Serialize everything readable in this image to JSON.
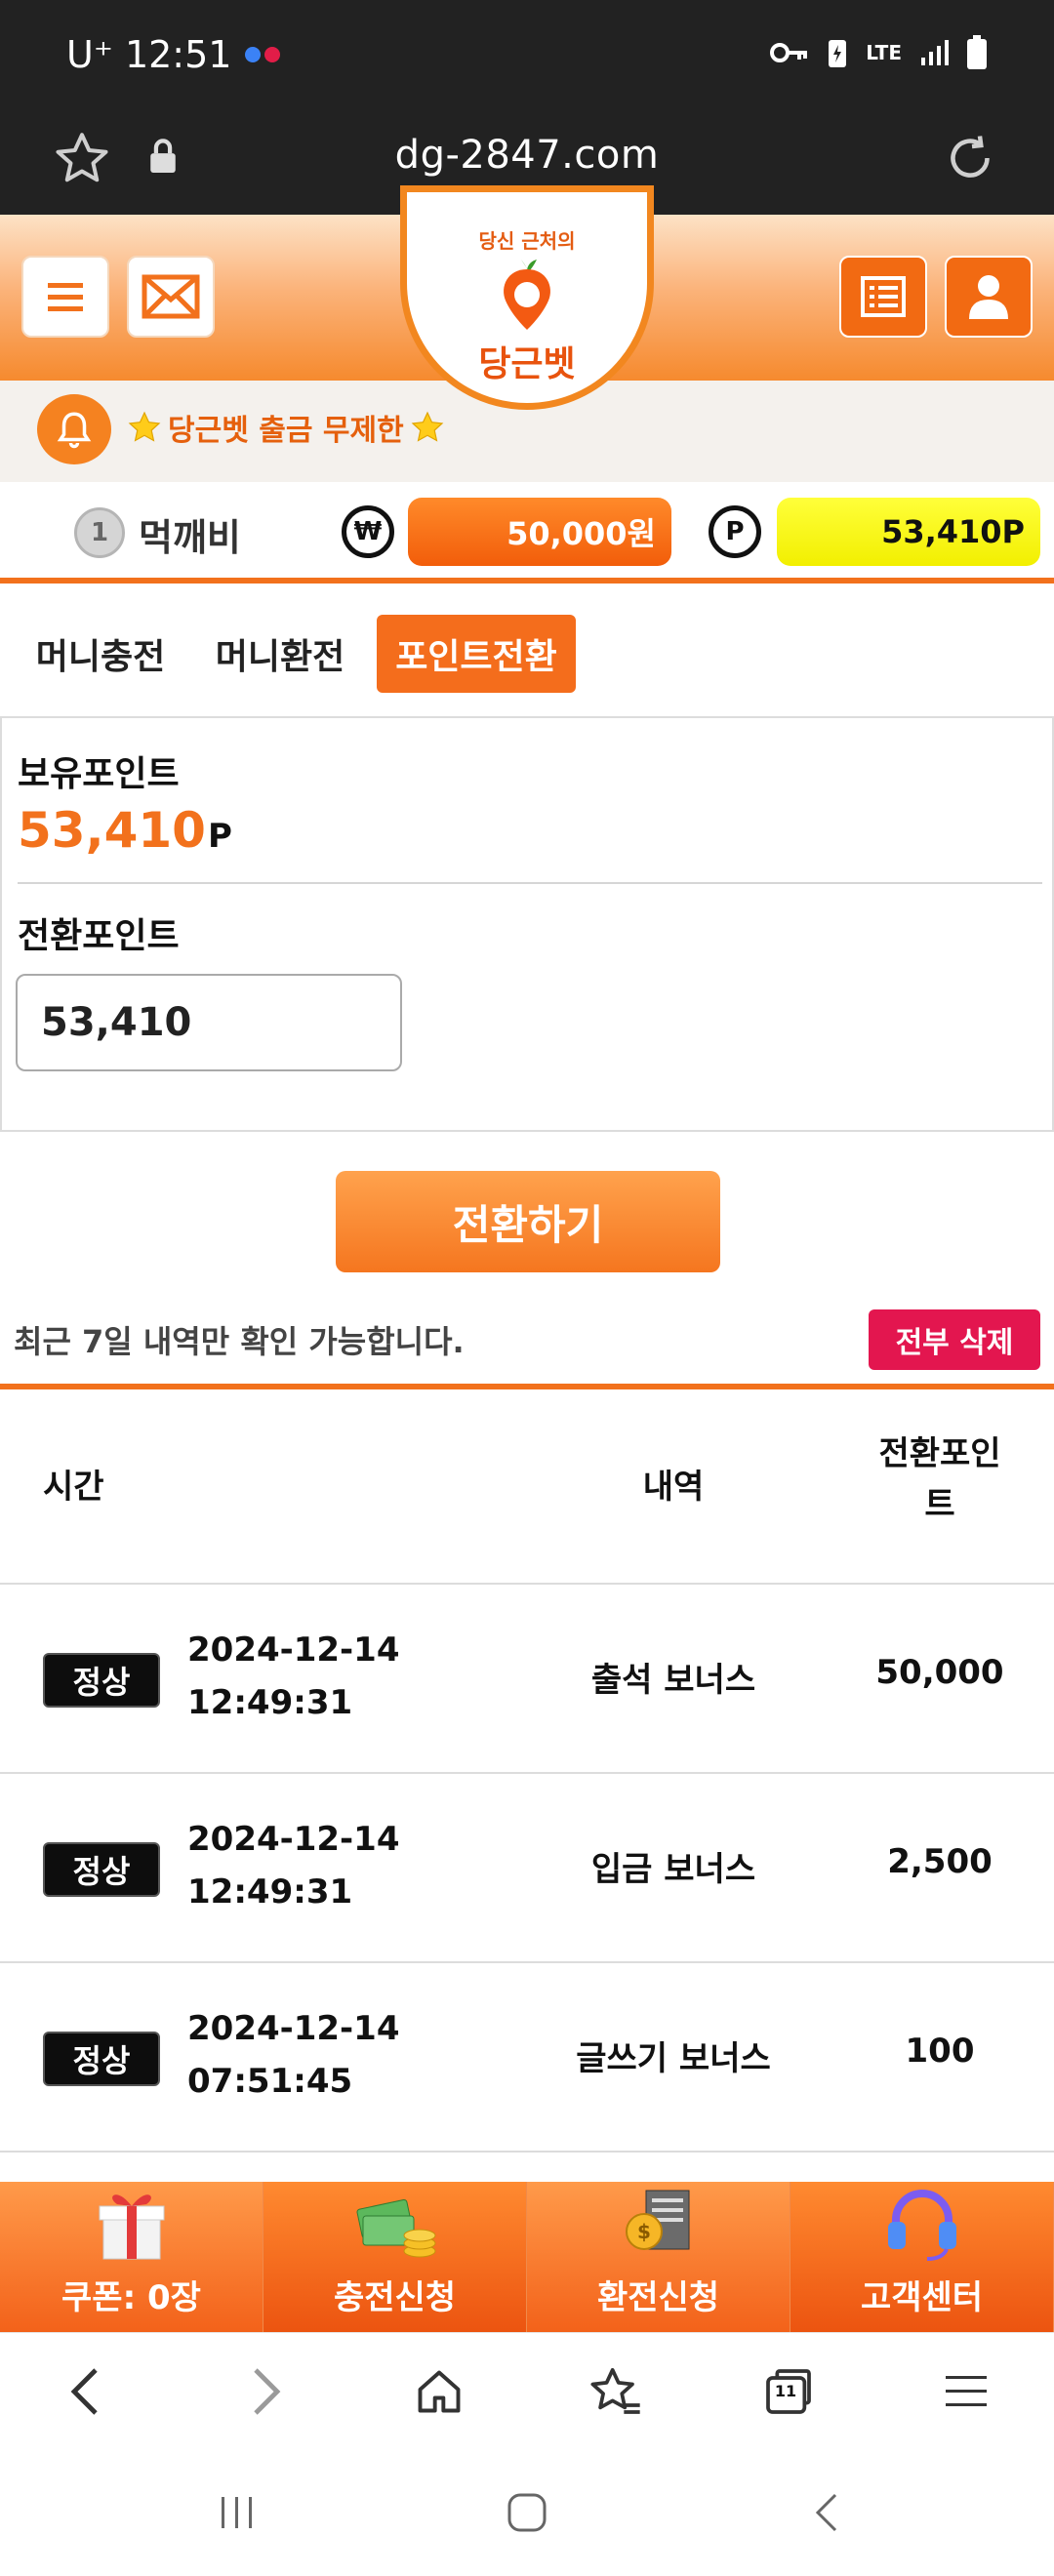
{
  "status_bar": {
    "carrier_time": "U⁺ 12:51",
    "network": "LTE"
  },
  "browser": {
    "url": "dg-2847.com"
  },
  "site": {
    "logo_tagline": "당신 근처의",
    "logo_name": "당근벳",
    "notice": "당근벳 출금 무제한"
  },
  "balance": {
    "level_badge": "1",
    "username": "먹깨비",
    "money_symbol": "₩",
    "money": "50,000원",
    "point_symbol": "P",
    "points": "53,410P"
  },
  "tabs": [
    {
      "label": "머니충전",
      "active": false
    },
    {
      "label": "머니환전",
      "active": false
    },
    {
      "label": "포인트전환",
      "active": true
    }
  ],
  "form": {
    "held_points_label": "보유포인트",
    "held_points_value": "53,410",
    "held_points_unit": "P",
    "convert_points_label": "전환포인트",
    "convert_points_input": "53,410",
    "convert_button": "전환하기"
  },
  "history": {
    "note": "최근 7일 내역만 확인 가능합니다.",
    "delete_all": "전부 삭제",
    "columns": {
      "time": "시간",
      "detail": "내역",
      "points": "전환포인\n트"
    },
    "rows": [
      {
        "status": "정상",
        "date": "2024-12-14",
        "time": "12:49:31",
        "detail": "출석 보너스",
        "points": "50,000"
      },
      {
        "status": "정상",
        "date": "2024-12-14",
        "time": "12:49:31",
        "detail": "입금 보너스",
        "points": "2,500"
      },
      {
        "status": "정상",
        "date": "2024-12-14",
        "time": "07:51:45",
        "detail": "글쓰기 보너스",
        "points": "100"
      }
    ]
  },
  "bottom_nav": [
    {
      "label": "쿠폰: 0장",
      "icon": "gift-icon"
    },
    {
      "label": "충전신청",
      "icon": "money-icon"
    },
    {
      "label": "환전신청",
      "icon": "exchange-icon"
    },
    {
      "label": "고객센터",
      "icon": "headset-icon"
    }
  ],
  "browser_toolbar": {
    "tab_count": "11"
  },
  "colors": {
    "brand_orange": "#f2711c",
    "point_yellow": "#f2ef00",
    "delete_red": "#e3164f"
  }
}
